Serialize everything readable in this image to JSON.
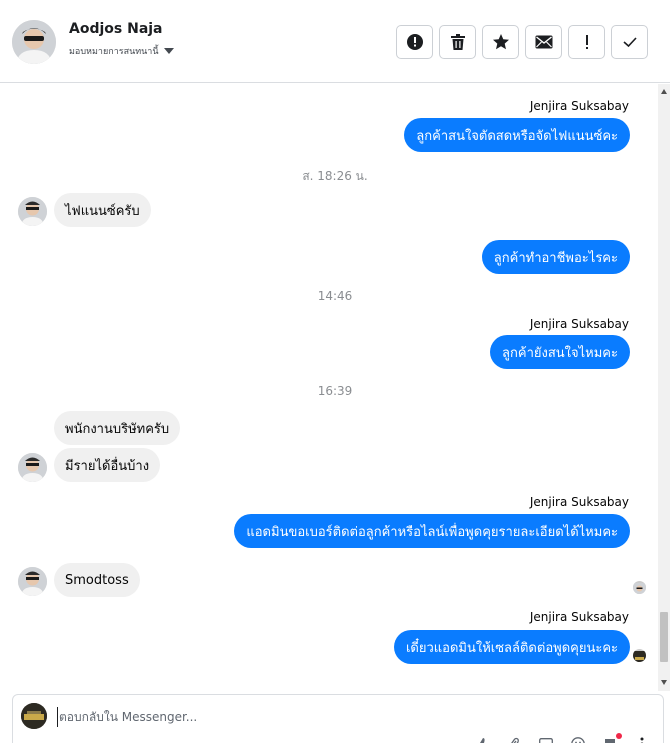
{
  "header": {
    "contact_name": "Aodjos Naja",
    "assign_label": "มอบหมายการสนทนานี้",
    "actions": [
      {
        "name": "report-spam-button",
        "icon": "alert-circle-icon"
      },
      {
        "name": "delete-button",
        "icon": "trash-icon"
      },
      {
        "name": "star-button",
        "icon": "star-icon"
      },
      {
        "name": "mark-unread-button",
        "icon": "envelope-icon"
      },
      {
        "name": "follow-up-button",
        "icon": "exclamation-icon"
      },
      {
        "name": "mark-done-button",
        "icon": "checkmark-icon"
      }
    ]
  },
  "thread": {
    "sender_name": "Jenjira Suksabay",
    "messages": {
      "m1": "ลูกค้าสนใจตัดสดหรือจัดไฟแนนซ์คะ",
      "m2": "ไฟแนนซ์ครับ",
      "m3": "ลูกค้าทำอาชีพอะไรคะ",
      "m4": "ลูกค้ายังสนใจไหมคะ",
      "m5": "พนักงานบริษัทครับ",
      "m6": "มีรายได้อื่นบ้าง",
      "m7": "แอดมินขอเบอร์ติดต่อลูกค้าหรือไลน์เพื่อพูดคุยรายละเอียดได้ไหมคะ",
      "m8": "Smodtoss",
      "m9": "เดี๋ยวแอดมินให้เซลล์ติดต่อพูดคุยนะคะ"
    },
    "timestamps": {
      "t1": "ส. 18:26 น.",
      "t2": "14:46",
      "t3": "16:39"
    }
  },
  "composer": {
    "placeholder": "ตอบกลับใน Messenger..."
  },
  "colors": {
    "outgoing_bubble": "#0a7cff",
    "incoming_bubble": "#f0f0f0",
    "notification_dot": "#f02849"
  }
}
